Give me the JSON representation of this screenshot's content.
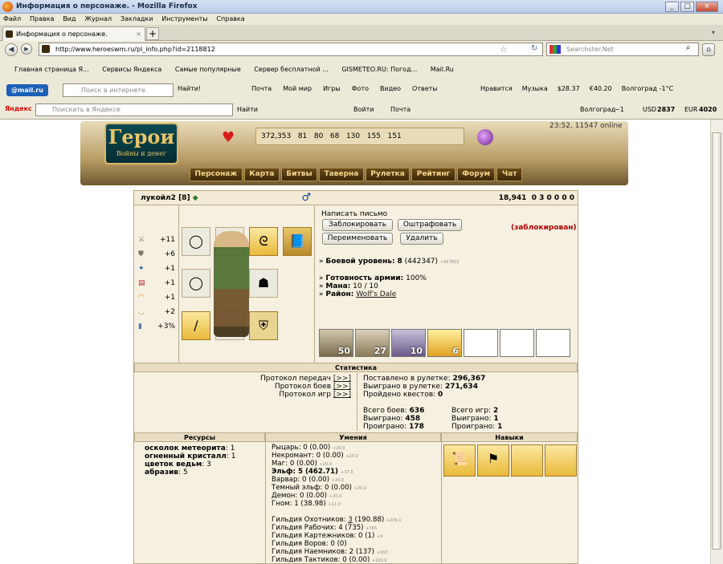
{
  "window": {
    "title": "Информация о персонаже. - Mozilla Firefox"
  },
  "menu": [
    "Файл",
    "Правка",
    "Вид",
    "Журнал",
    "Закладки",
    "Инструменты",
    "Справка"
  ],
  "tab": {
    "label": "Информация о персонаже.",
    "new_tab": "+"
  },
  "nav": {
    "url": "http://www.heroeswm.ru/pl_info.php?id=2118812",
    "search_placeholder": "Searchster.Net"
  },
  "bookmarks": [
    "Главная страница Я...",
    "Сервисы Яндекса",
    "Самые популярные",
    "Сервер бесплатной ...",
    "GISMETEO.RU: Погод...",
    "Mail.Ru"
  ],
  "mailbar": {
    "logo": "@mail.ru",
    "search_placeholder": "Поиск в интернете",
    "find": "Найти!",
    "items": [
      "Почта",
      "Мой мир",
      "Игры",
      "Фото",
      "Видео",
      "Ответы"
    ],
    "right": [
      "Нравится",
      "Музыка",
      "$28.37",
      "€40.20",
      "Волгоград -1°C"
    ]
  },
  "yabar": {
    "logo": "Яндекс",
    "search_placeholder": "Поискать в Яндексе",
    "find": "Найти",
    "login": "Войти",
    "mail": "Почта",
    "city": "Волгоград",
    "temp": "−1",
    "usd_label": "USD",
    "usd": "2837",
    "eur_label": "EUR",
    "eur": "4020"
  },
  "game": {
    "logo_title": "Герои",
    "logo_sub": "Войны и денег",
    "online": "23:52, 11547 online",
    "resources_top": [
      "372,353",
      "81",
      "80",
      "68",
      "130",
      "155",
      "151"
    ],
    "nav": [
      "Персонаж",
      "Карта",
      "Битвы",
      "Таверна",
      "Рулетка",
      "Рейтинг",
      "Форум",
      "Чат"
    ]
  },
  "player": {
    "name": "лукойл2",
    "level": "[8]",
    "gold": "18,941",
    "res": [
      "0",
      "3",
      "0",
      "0",
      "0",
      "0"
    ],
    "stats": [
      "+11",
      "+6",
      "+1",
      "+1",
      "+1",
      "+2",
      "+3%"
    ],
    "write": "Написать письмо",
    "btn_block": "Заблокировать",
    "btn_fine": "Оштрафовать",
    "btn_rename": "Переименовать",
    "btn_delete": "Удалить",
    "blocked": "(заблокирован)",
    "combat_label": "Боевой уровень:",
    "combat": "8",
    "exp": "(442347)",
    "exp_next": "+417653",
    "army_label": "Готовность армии:",
    "army": "100%",
    "mana_label": "Мана:",
    "mana": "10 / 10",
    "district_label": "Район:",
    "district": "Wolf's Dale",
    "troops": [
      "50",
      "27",
      "10",
      "6"
    ]
  },
  "stats_section": {
    "title": "Статистика",
    "proto": [
      "Протокол передач",
      "Протокол боев",
      "Протокол игр"
    ],
    "proto_link": "[>>]",
    "placed_label": "Поставлено в рулетке:",
    "placed": "296,367",
    "won_label": "Выиграно в рулетке:",
    "won": "271,634",
    "quests_label": "Пройдено квестов:",
    "quests": "0",
    "battles_label": "Всего боев:",
    "battles": "636",
    "bwon_label": "Выиграно:",
    "bwon": "458",
    "blost_label": "Проиграно:",
    "blost": "178",
    "games_label": "Всего игр:",
    "games": "2",
    "gwon_label": "Выиграно:",
    "gwon": "1",
    "glost_label": "Проиграно:",
    "glost": "1"
  },
  "resources": {
    "title": "Ресурсы",
    "items": [
      {
        "name": "осколок метеорита",
        "count": "1"
      },
      {
        "name": "огненный кристалл",
        "count": "1"
      },
      {
        "name": "цветок ведьм",
        "count": "3"
      },
      {
        "name": "абразив",
        "count": "5"
      }
    ]
  },
  "skills": {
    "title": "Умения",
    "lines": [
      {
        "name": "Рыцарь:",
        "value": "0 (0.00)",
        "plus": "+20.0"
      },
      {
        "name": "Некромант:",
        "value": "0 (0.00)",
        "plus": "+20.0"
      },
      {
        "name": "Маг:",
        "value": "0 (0.00)",
        "plus": "+20.0"
      },
      {
        "name": "Эльф:",
        "value": "5 (462.71)",
        "plus": "+37.3"
      },
      {
        "name": "Варвар:",
        "value": "0 (0.00)",
        "plus": "+20.0"
      },
      {
        "name": "Темный эльф:",
        "value": "0 (0.00)",
        "plus": "+20.0"
      },
      {
        "name": "Демон:",
        "value": "0 (0.00)",
        "plus": "+20.0"
      },
      {
        "name": "Гном:",
        "value": "1 (38.98)",
        "plus": "+11.0"
      }
    ],
    "guilds": [
      {
        "name": "Гильдия Охотников:",
        "value": "3",
        "rest": "(190.88)",
        "plus": "+209.1"
      },
      {
        "name": "Гильдия Рабочих:",
        "value": "4 (735)",
        "rest": "",
        "plus": "+765"
      },
      {
        "name": "Гильдия Картежников:",
        "value": "0 (1)",
        "rest": "",
        "plus": "+9"
      },
      {
        "name": "Гильдия Воров:",
        "value": "0 (0)",
        "rest": "",
        "plus": ""
      },
      {
        "name": "Гильдия Наемников:",
        "value": "2 (137)",
        "rest": "",
        "plus": "+163"
      },
      {
        "name": "Гильдия Тактиков:",
        "value": "0 (0.00)",
        "rest": "",
        "plus": "+100.0"
      }
    ]
  },
  "abilities": {
    "title": "Навыки"
  }
}
